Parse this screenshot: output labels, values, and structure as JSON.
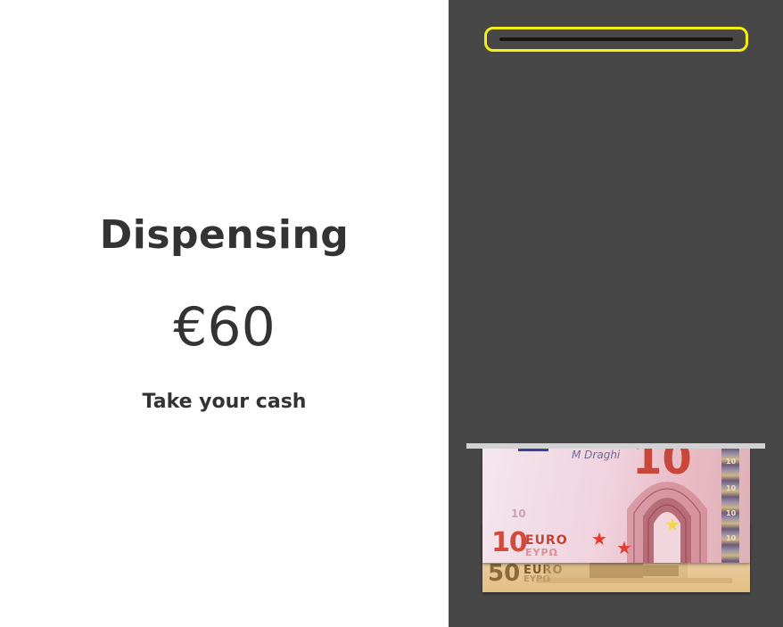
{
  "status": {
    "title": "Dispensing",
    "amount": "€60",
    "instruction": "Take your cash"
  },
  "machine": {
    "colors": {
      "panel": "#474747",
      "card_slot_highlight": "#f4ee15",
      "cash_slot": "#d2d2d2",
      "text": "#333333"
    },
    "card_slot_icon": "card-slot-icon",
    "banknotes": [
      {
        "denomination": "10",
        "currency_label": "EURO",
        "currency_sub": "EYPΩ",
        "faint_value": "10",
        "signature": "M Draghi",
        "hologram_marks": [
          "10",
          "10",
          "10",
          "10"
        ],
        "color": "#f0d3de"
      },
      {
        "denomination": "50",
        "currency_label": "EURO",
        "currency_sub": "EYPΩ",
        "color": "#e8cfa4"
      }
    ]
  }
}
